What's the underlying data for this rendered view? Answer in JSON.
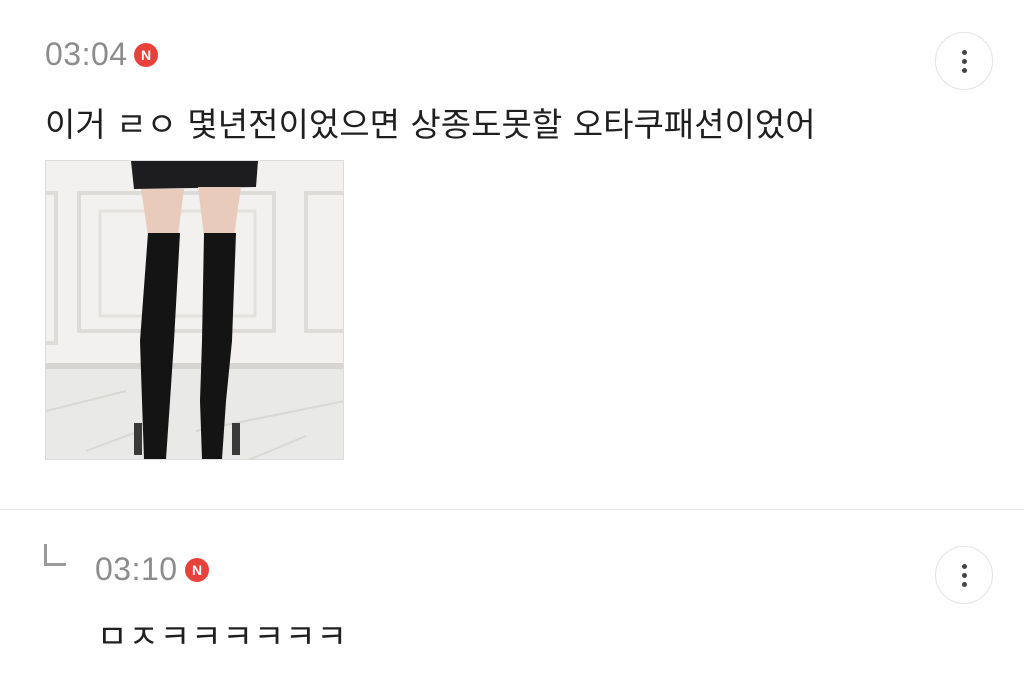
{
  "post": {
    "time": "03:04",
    "new_badge": "N",
    "text": "이거 ㄹㅇ 몇년전이었으면 상종도못할 오타쿠패션이었어",
    "image_icon": "photo-thumbnail-icon",
    "more_icon": "more-vertical-icon"
  },
  "reply": {
    "time": "03:10",
    "new_badge": "N",
    "text": "ㅁㅈㅋㅋㅋㅋㅋㅋ",
    "reply_icon": "reply-arrow-icon",
    "more_icon": "more-vertical-icon"
  },
  "colors": {
    "badge": "#e8413b",
    "time_text": "#8c8c8c",
    "body_text": "#1f1f1f",
    "divider": "#e4e4e4"
  }
}
